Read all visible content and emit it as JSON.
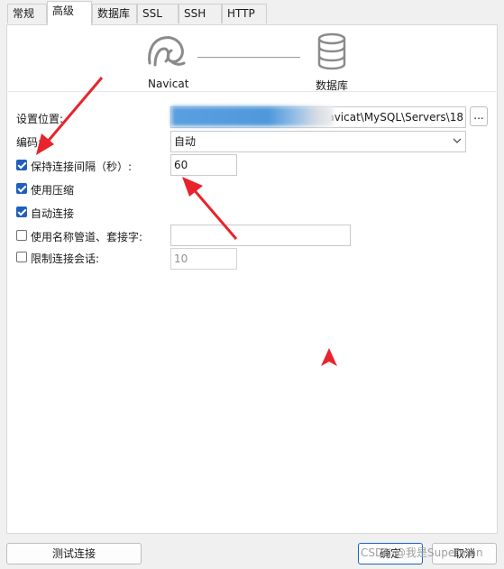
{
  "tabs": [
    {
      "label": "常规",
      "active": false
    },
    {
      "label": "高级",
      "active": true
    },
    {
      "label": "数据库",
      "active": false
    },
    {
      "label": "SSL",
      "active": false
    },
    {
      "label": "SSH",
      "active": false
    },
    {
      "label": "HTTP",
      "active": false
    }
  ],
  "header": {
    "left_label": "Navicat",
    "right_label": "数据库"
  },
  "form": {
    "settings_location_label": "设置位置:",
    "settings_location_value": "avicat\\MySQL\\Servers\\18",
    "browse_label": "...",
    "encoding_label": "编码:",
    "encoding_value": "自动",
    "keepalive_label": "保持连接间隔（秒）:",
    "keepalive_checked": true,
    "keepalive_value": "60",
    "compression_label": "使用压缩",
    "compression_checked": true,
    "autoconnect_label": "自动连接",
    "autoconnect_checked": true,
    "namedpipe_label": "使用名称管道、套接字:",
    "namedpipe_checked": false,
    "namedpipe_value": "",
    "limit_sessions_label": "限制连接会话:",
    "limit_sessions_checked": false,
    "limit_sessions_value": "10"
  },
  "footer": {
    "test_button": "测试连接",
    "ok_button": "确定",
    "cancel_button": "取消",
    "watermark": "CSDN @我是Superman"
  },
  "colors": {
    "accent": "#1f5fbf",
    "arrow": "#e8232b"
  }
}
